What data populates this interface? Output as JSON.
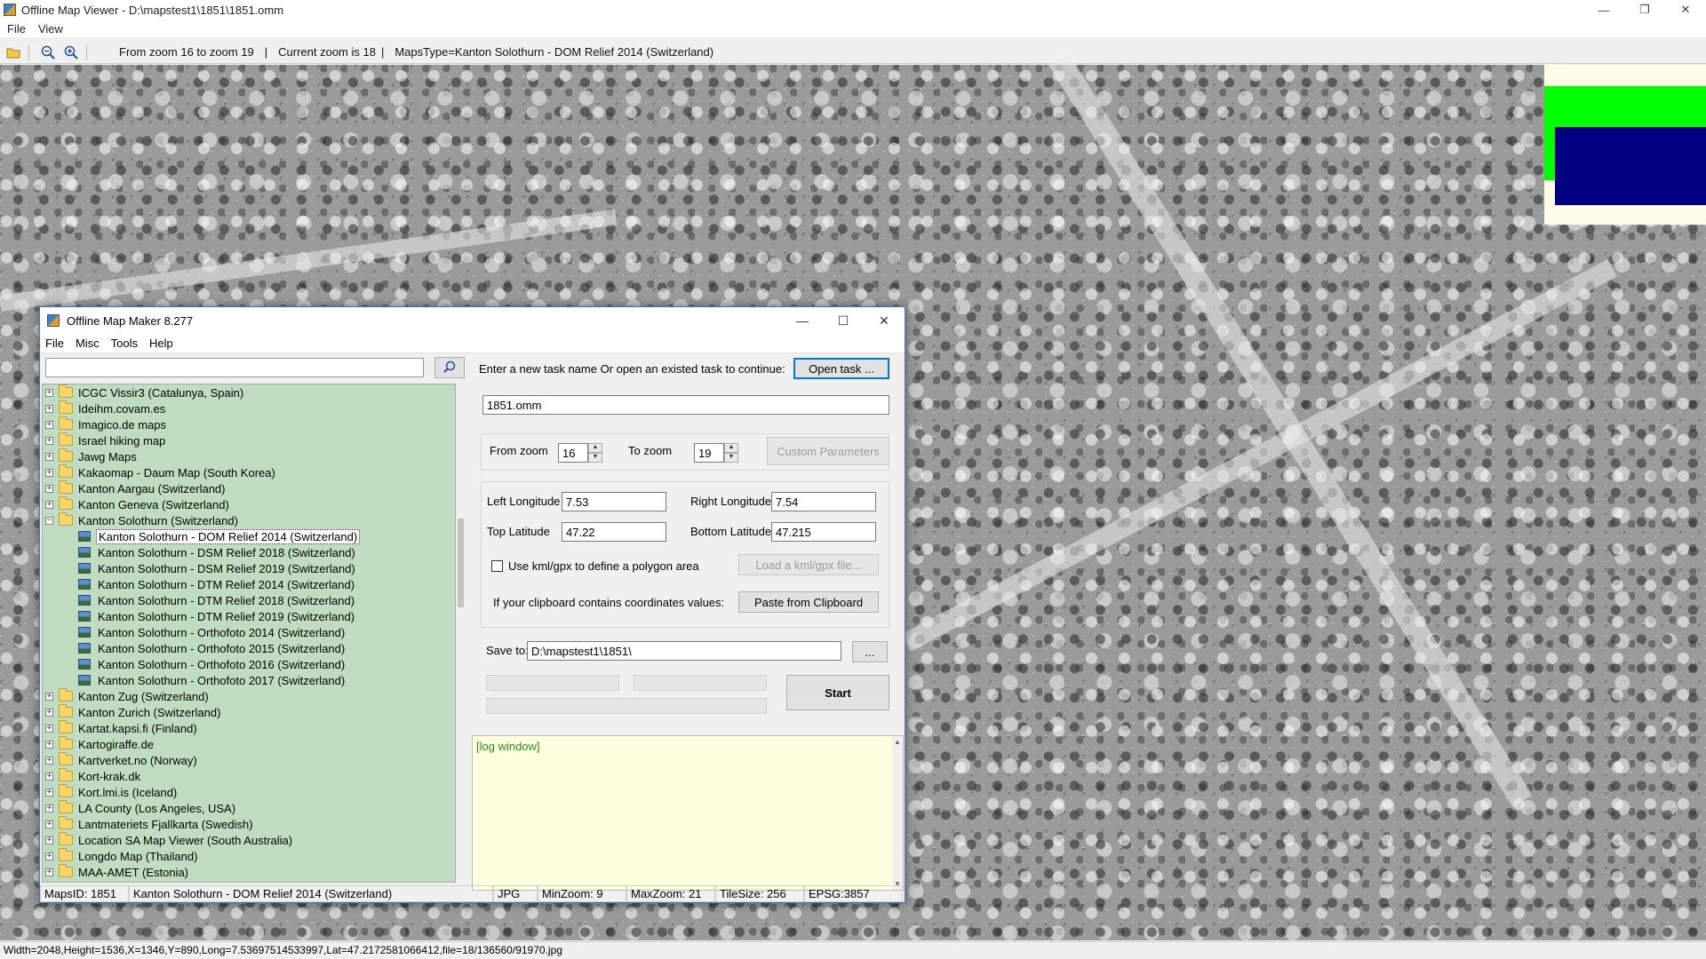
{
  "viewer": {
    "title": "Offline Map Viewer - D:\\mapstest1\\1851\\1851.omm",
    "menu": [
      "File",
      "View"
    ],
    "info": {
      "zoom_range": "From zoom 16 to zoom 19",
      "sep1": "|",
      "current_zoom": "Current zoom is 18",
      "sep2": "|",
      "maps_type": "MapsType=Kanton Solothurn - DOM Relief 2014 (Switzerland)"
    },
    "status": "Width=2048,Height=1536,X=1346,Y=890,Long=7.53697514533997,Lat=47.2172581066412,file=18/136560/91970.jpg",
    "overview_colors": {
      "frame": "#00ff00",
      "view": "#000080"
    }
  },
  "dialog": {
    "title": "Offline Map Maker 8.277",
    "menu": [
      "File",
      "Misc",
      "Tools",
      "Help"
    ],
    "search": {
      "value": ""
    },
    "tree": [
      {
        "label": "ICGC Vissir3 (Catalunya, Spain)",
        "expander": "+"
      },
      {
        "label": "Ideihm.covam.es",
        "expander": "+"
      },
      {
        "label": "Imagico.de maps",
        "expander": "+"
      },
      {
        "label": "Israel hiking map",
        "expander": "+"
      },
      {
        "label": "Jawg Maps",
        "expander": "+"
      },
      {
        "label": "Kakaomap - Daum Map (South Korea)",
        "expander": "+"
      },
      {
        "label": "Kanton Aargau (Switzerland)",
        "expander": "+"
      },
      {
        "label": "Kanton Geneva (Switzerland)",
        "expander": "+"
      },
      {
        "label": "Kanton Solothurn (Switzerland)",
        "expander": "−"
      }
    ],
    "tree_children": [
      "Kanton Solothurn - DOM Relief 2014 (Switzerland)",
      "Kanton Solothurn - DSM Relief 2018 (Switzerland)",
      "Kanton Solothurn - DSM Relief 2019 (Switzerland)",
      "Kanton Solothurn - DTM Relief 2014 (Switzerland)",
      "Kanton Solothurn - DTM Relief 2018 (Switzerland)",
      "Kanton Solothurn - DTM Relief 2019 (Switzerland)",
      "Kanton Solothurn - Orthofoto 2014 (Switzerland)",
      "Kanton Solothurn - Orthofoto 2015 (Switzerland)",
      "Kanton Solothurn - Orthofoto 2016 (Switzerland)",
      "Kanton Solothurn - Orthofoto 2017 (Switzerland)"
    ],
    "tree_after": [
      {
        "label": "Kanton Zug (Switzerland)",
        "expander": "+"
      },
      {
        "label": "Kanton Zurich (Switzerland)",
        "expander": "+"
      },
      {
        "label": "Kartat.kapsi.fi (Finland)",
        "expander": "+"
      },
      {
        "label": "Kartogiraffe.de",
        "expander": "+"
      },
      {
        "label": "Kartverket.no (Norway)",
        "expander": "+"
      },
      {
        "label": "Kort-krak.dk",
        "expander": "+"
      },
      {
        "label": "Kort.lmi.is (Iceland)",
        "expander": "+"
      },
      {
        "label": "LA County (Los Angeles, USA)",
        "expander": "+"
      },
      {
        "label": "Lantmateriets Fjallkarta (Swedish)",
        "expander": "+"
      },
      {
        "label": "Location SA Map Viewer (South Australia)",
        "expander": "+"
      },
      {
        "label": "Longdo Map (Thailand)",
        "expander": "+"
      },
      {
        "label": "MAA-AMET (Estonia)",
        "expander": "+"
      }
    ],
    "prompt": "Enter a new task name Or open an existed task to continue:",
    "open_task": "Open task ...",
    "task_name": "1851.omm",
    "from_zoom_label": "From zoom",
    "from_zoom": "16",
    "to_zoom_label": "To zoom",
    "to_zoom": "19",
    "custom_params": "Custom Parameters",
    "left_lon_label": "Left Longitude",
    "left_lon": "7.53",
    "right_lon_label": "Right Longitude",
    "right_lon": "7.54",
    "top_lat_label": "Top Latitude",
    "top_lat": "47.22",
    "bottom_lat_label": "Bottom Latitude",
    "bottom_lat": "47.215",
    "kml_check_label": "Use kml/gpx to define a polygon area",
    "load_kml": "Load a kml/gpx file...",
    "clipboard_label": "If your clipboard contains coordinates values:",
    "paste_clipboard": "Paste from Clipboard",
    "save_to_label": "Save to:",
    "save_to": "D:\\mapstest1\\1851\\",
    "browse": "...",
    "start": "Start",
    "log": "[log window]",
    "status": {
      "maps_id": "MapsID: 1851",
      "maps_name": "Kanton Solothurn - DOM Relief 2014 (Switzerland)",
      "format": "JPG",
      "min_zoom": "MinZoom: 9",
      "max_zoom": "MaxZoom: 21",
      "tile_size": "TileSize: 256",
      "epsg": "EPSG:3857"
    }
  }
}
